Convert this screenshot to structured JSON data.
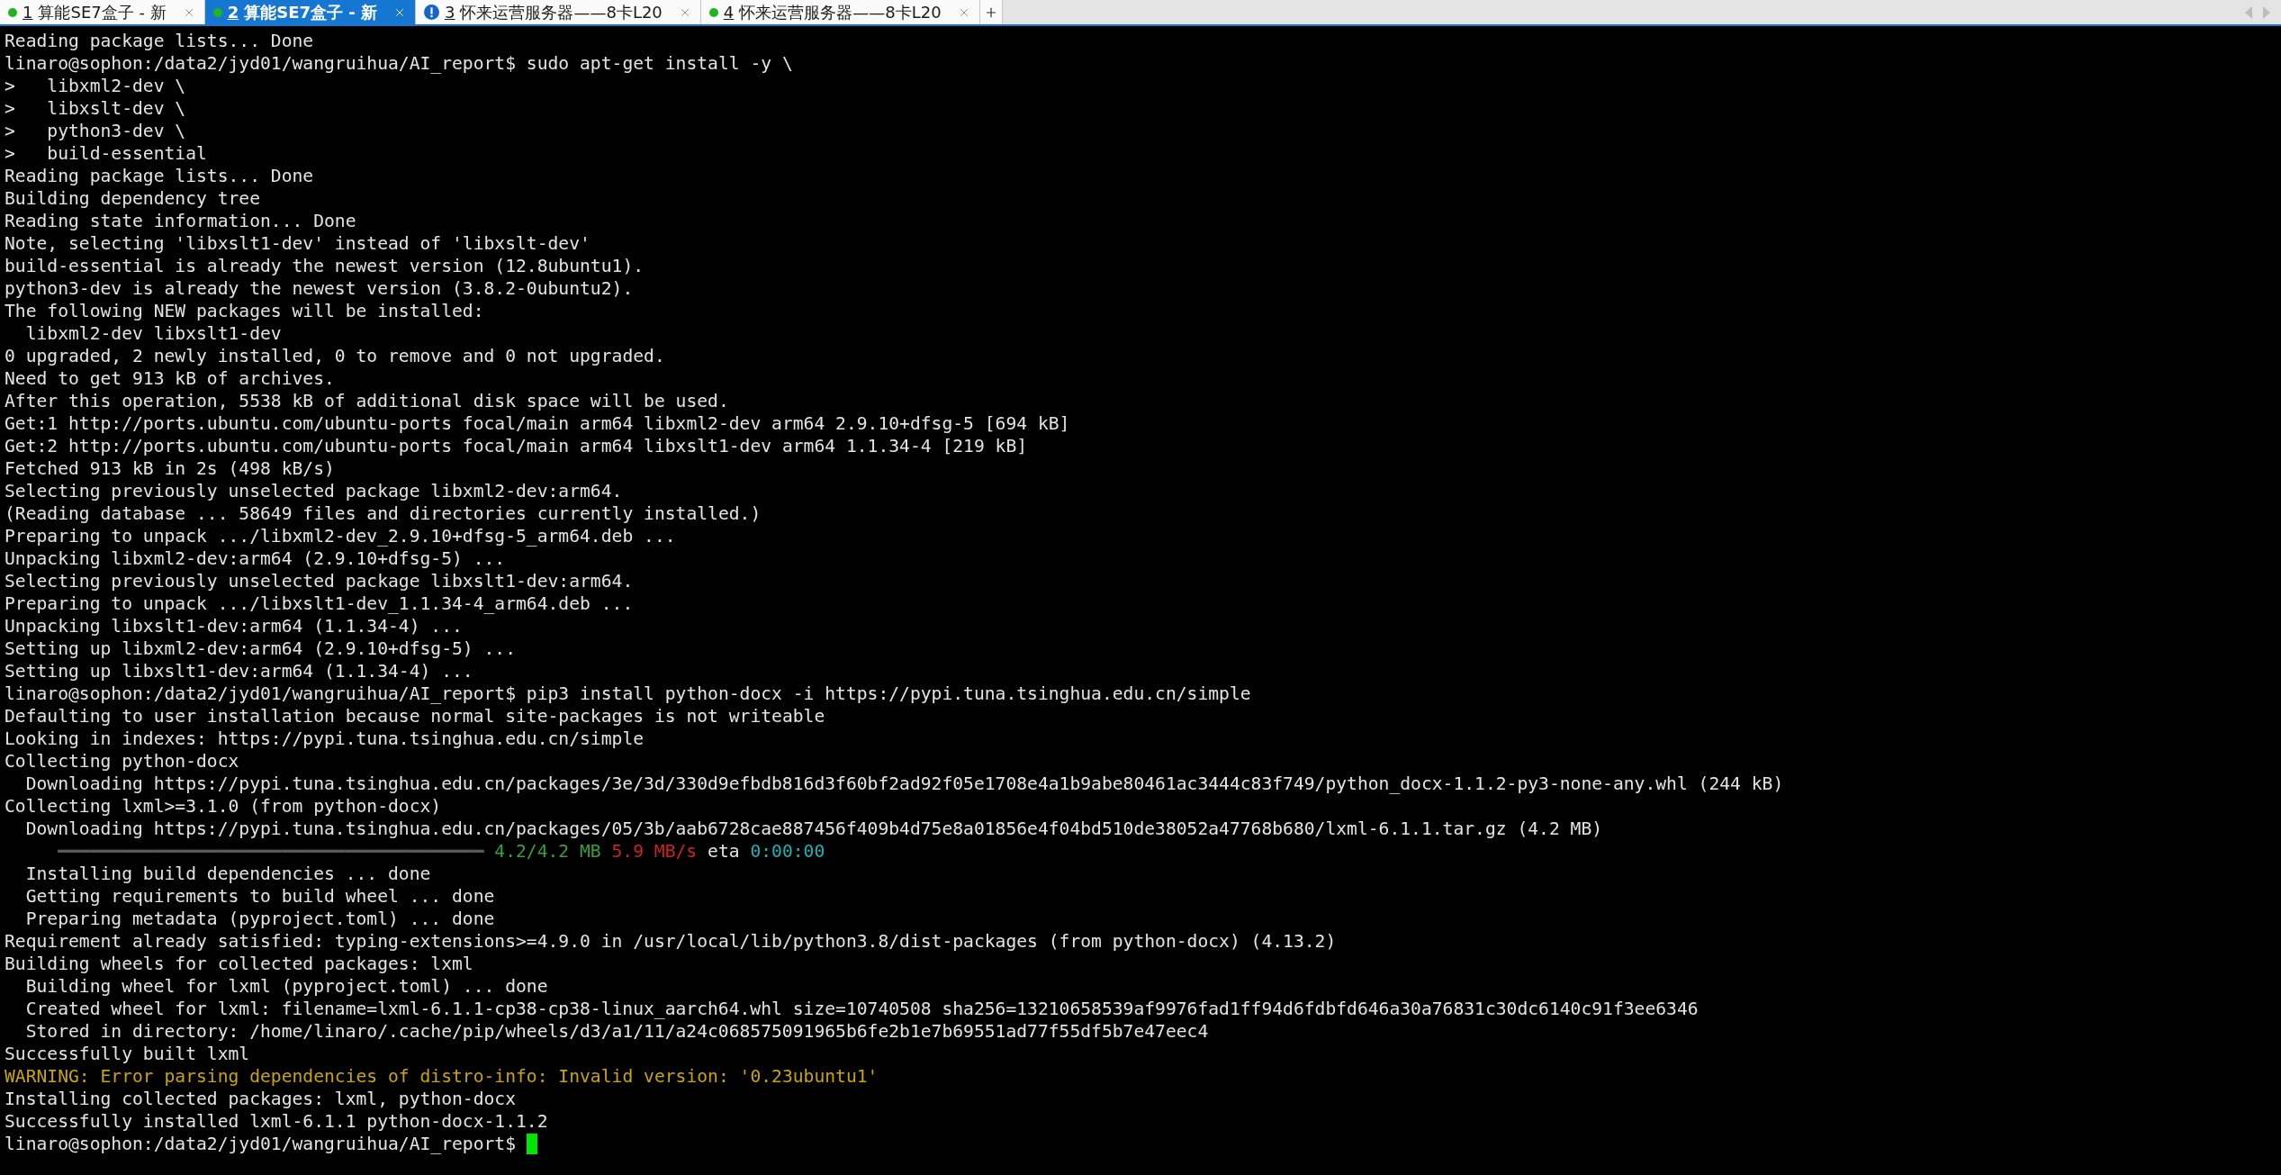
{
  "tabs": [
    {
      "number": "1",
      "title": "算能SE7盒子 - 新",
      "kind": "connected",
      "selected": false
    },
    {
      "number": "2",
      "title": "算能SE7盒子 - 新",
      "kind": "connected",
      "selected": true
    },
    {
      "number": "3",
      "title": "怀来运营服务器——8卡L20",
      "kind": "alert",
      "selected": false
    },
    {
      "number": "4",
      "title": "怀来运营服务器——8卡L20",
      "kind": "connected",
      "selected": false
    }
  ],
  "terminal": {
    "lines": [
      {
        "kind": "output",
        "text": "Reading package lists... Done"
      },
      {
        "kind": "output",
        "text": "linaro@sophon:/data2/jyd01/wangruihua/AI_report$ sudo apt-get install -y \\"
      },
      {
        "kind": "output",
        "text": ">   libxml2-dev \\"
      },
      {
        "kind": "output",
        "text": ">   libxslt-dev \\"
      },
      {
        "kind": "output",
        "text": ">   python3-dev \\"
      },
      {
        "kind": "output",
        "text": ">   build-essential"
      },
      {
        "kind": "output",
        "text": "Reading package lists... Done"
      },
      {
        "kind": "output",
        "text": "Building dependency tree"
      },
      {
        "kind": "output",
        "text": "Reading state information... Done"
      },
      {
        "kind": "output",
        "text": "Note, selecting 'libxslt1-dev' instead of 'libxslt-dev'"
      },
      {
        "kind": "output",
        "text": "build-essential is already the newest version (12.8ubuntu1)."
      },
      {
        "kind": "output",
        "text": "python3-dev is already the newest version (3.8.2-0ubuntu2)."
      },
      {
        "kind": "output",
        "text": "The following NEW packages will be installed:"
      },
      {
        "kind": "indented",
        "text": "libxml2-dev libxslt1-dev"
      },
      {
        "kind": "output",
        "text": "0 upgraded, 2 newly installed, 0 to remove and 0 not upgraded."
      },
      {
        "kind": "output",
        "text": "Need to get 913 kB of archives."
      },
      {
        "kind": "output",
        "text": "After this operation, 5538 kB of additional disk space will be used."
      },
      {
        "kind": "output",
        "text": "Get:1 http://ports.ubuntu.com/ubuntu-ports focal/main arm64 libxml2-dev arm64 2.9.10+dfsg-5 [694 kB]"
      },
      {
        "kind": "output",
        "text": "Get:2 http://ports.ubuntu.com/ubuntu-ports focal/main arm64 libxslt1-dev arm64 1.1.34-4 [219 kB]"
      },
      {
        "kind": "output",
        "text": "Fetched 913 kB in 2s (498 kB/s)"
      },
      {
        "kind": "output",
        "text": "Selecting previously unselected package libxml2-dev:arm64."
      },
      {
        "kind": "output",
        "text": "(Reading database ... 58649 files and directories currently installed.)"
      },
      {
        "kind": "output",
        "text": "Preparing to unpack .../libxml2-dev_2.9.10+dfsg-5_arm64.deb ..."
      },
      {
        "kind": "output",
        "text": "Unpacking libxml2-dev:arm64 (2.9.10+dfsg-5) ..."
      },
      {
        "kind": "output",
        "text": "Selecting previously unselected package libxslt1-dev:arm64."
      },
      {
        "kind": "output",
        "text": "Preparing to unpack .../libxslt1-dev_1.1.34-4_arm64.deb ..."
      },
      {
        "kind": "output",
        "text": "Unpacking libxslt1-dev:arm64 (1.1.34-4) ..."
      },
      {
        "kind": "output",
        "text": "Setting up libxml2-dev:arm64 (2.9.10+dfsg-5) ..."
      },
      {
        "kind": "output",
        "text": "Setting up libxslt1-dev:arm64 (1.1.34-4) ..."
      },
      {
        "kind": "output",
        "text": "linaro@sophon:/data2/jyd01/wangruihua/AI_report$ pip3 install python-docx -i https://pypi.tuna.tsinghua.edu.cn/simple"
      },
      {
        "kind": "output",
        "text": "Defaulting to user installation because normal site-packages is not writeable"
      },
      {
        "kind": "output",
        "text": "Looking in indexes: https://pypi.tuna.tsinghua.edu.cn/simple"
      },
      {
        "kind": "output",
        "text": "Collecting python-docx"
      },
      {
        "kind": "indented",
        "text": "Downloading https://pypi.tuna.tsinghua.edu.cn/packages/3e/3d/330d9efbdb816d3f60bf2ad92f05e1708e4a1b9abe80461ac3444c83f749/python_docx-1.1.2-py3-none-any.whl (244 kB)"
      },
      {
        "kind": "output",
        "text": "Collecting lxml>=3.1.0 (from python-docx)"
      },
      {
        "kind": "indented",
        "text": "Downloading https://pypi.tuna.tsinghua.edu.cn/packages/05/3b/aab6728cae887456f409b4d75e8a01856e4f04bd510de38052a47768b680/lxml-6.1.1.tar.gz (4.2 MB)"
      },
      {
        "kind": "progress",
        "bar": "━━━━━━━━━━━━━━━━━━━━━━━━━━━━━━━━━━━━━━━━",
        "downloaded": "4.2/4.2 MB",
        "speed": "5.9 MB/s",
        "eta_label": "eta",
        "eta": "0:00:00"
      },
      {
        "kind": "indented",
        "text": "Installing build dependencies ... done"
      },
      {
        "kind": "indented",
        "text": "Getting requirements to build wheel ... done"
      },
      {
        "kind": "indented",
        "text": "Preparing metadata (pyproject.toml) ... done"
      },
      {
        "kind": "output",
        "text": "Requirement already satisfied: typing-extensions>=4.9.0 in /usr/local/lib/python3.8/dist-packages (from python-docx) (4.13.2)"
      },
      {
        "kind": "output",
        "text": "Building wheels for collected packages: lxml"
      },
      {
        "kind": "indented",
        "text": "Building wheel for lxml (pyproject.toml) ... done"
      },
      {
        "kind": "indented",
        "text": "Created wheel for lxml: filename=lxml-6.1.1-cp38-cp38-linux_aarch64.whl size=10740508 sha256=13210658539af9976fad1ff94d6fdbfd646a30a76831c30dc6140c91f3ee6346"
      },
      {
        "kind": "indented",
        "text": "Stored in directory: /home/linaro/.cache/pip/wheels/d3/a1/11/a24c068575091965b6fe2b1e7b69551ad77f55df5b7e47eec4"
      },
      {
        "kind": "output",
        "text": "Successfully built lxml"
      },
      {
        "kind": "warning",
        "text": "WARNING: Error parsing dependencies of distro-info: Invalid version: '0.23ubuntu1'"
      },
      {
        "kind": "output",
        "text": "Installing collected packages: lxml, python-docx"
      },
      {
        "kind": "output",
        "text": "Successfully installed lxml-6.1.1 python-docx-1.1.2"
      },
      {
        "kind": "input",
        "text": "linaro@sophon:/data2/jyd01/wangruihua/AI_report$"
      }
    ]
  }
}
